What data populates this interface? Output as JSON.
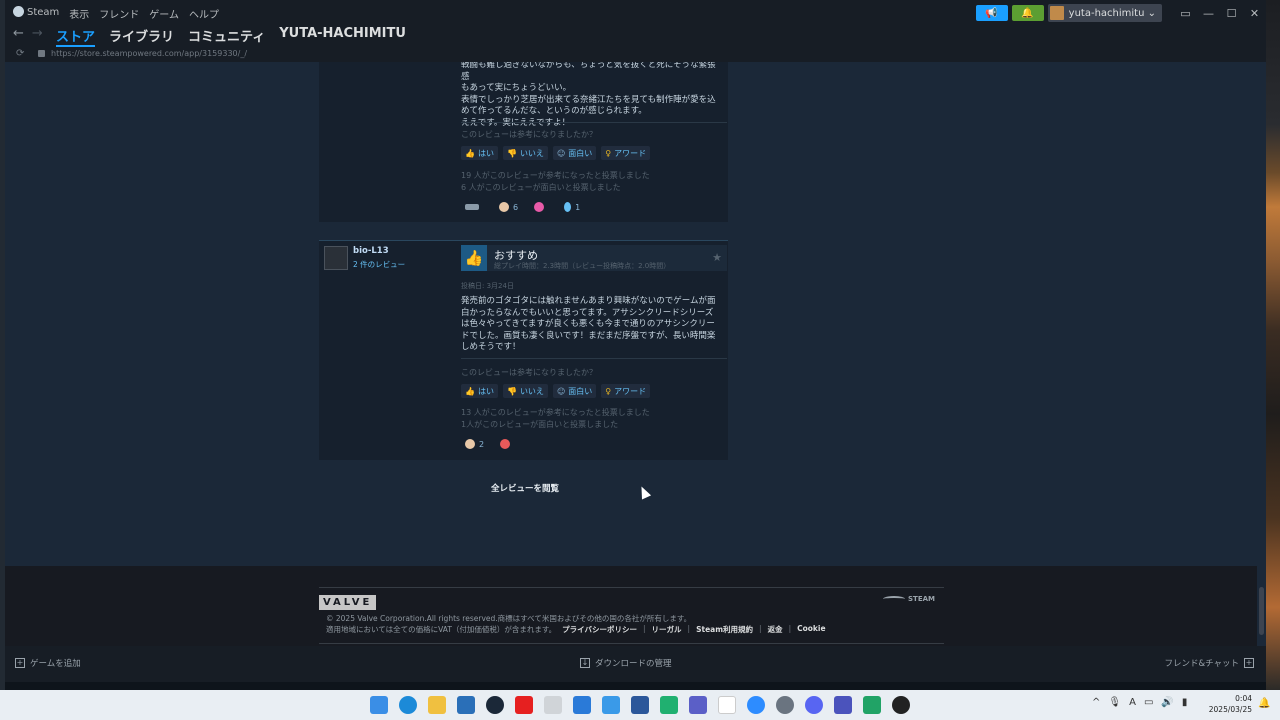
{
  "menubar": {
    "app": "Steam",
    "items": [
      "表示",
      "フレンド",
      "ゲーム",
      "ヘルプ"
    ]
  },
  "account": {
    "name": "yuta-hachimitu"
  },
  "nav": {
    "tabs": [
      "ストア",
      "ライブラリ",
      "コミュニティ",
      "YUTA-HACHIMITU"
    ]
  },
  "url": "https://store.steampowered.com/app/3159330/_/",
  "review1": {
    "body_lines": [
      "戦闘も難し過ぎないながらも、ちょっと気を抜くと死にそうな緊張感",
      "もあって実にちょうどいい。",
      "表情でしっかり芝居が出来てる奈緒江たちを見ても制作陣が愛を込",
      "めて作ってるんだな、というのが感じられます。",
      "ええです。実にええですよ！"
    ],
    "helpful_q": "このレビューは参考になりましたか？",
    "buttons": [
      "はい",
      "いいえ",
      "面白い",
      "アワード"
    ],
    "stats": [
      "19 人がこのレビューが参考になったと投票しました",
      "6 人がこのレビューが面白いと投票しました"
    ],
    "awards": [
      {
        "icon": "wings-award-icon",
        "count": ""
      },
      {
        "icon": "hand-award-icon",
        "count": "6"
      },
      {
        "icon": "heart-award-icon",
        "count": ""
      },
      {
        "icon": "medal-award-icon",
        "count": "1"
      }
    ]
  },
  "review2": {
    "author": "bio-L13",
    "author_reviews": "2 件のレビュー",
    "verdict": "おすすめ",
    "hours": "総プレイ時間：2.3時間（レビュー投稿時点：2.0時間）",
    "posted": "投稿日: 3月24日",
    "body_lines": [
      "発売前のゴタゴタには触れませんあまり興味がないのでゲームが面",
      "白かったらなんでもいいと思ってます。アサシンクリードシリーズ",
      "は色々やってきてますが良くも悪くも今まで通りのアサシンクリー",
      "ドでした。画質も凄く良いです！まだまだ序盤ですが、長い時間楽",
      "しめそうです！"
    ],
    "helpful_q": "このレビューは参考になりましたか？",
    "buttons": [
      "はい",
      "いいえ",
      "面白い",
      "アワード"
    ],
    "stats": [
      "13 人がこのレビューが参考になったと投票しました",
      "1人がこのレビューが面白いと投票しました"
    ],
    "awards": [
      {
        "icon": "hand-award-icon",
        "count": "2"
      },
      {
        "icon": "face-award-icon",
        "count": ""
      }
    ]
  },
  "view_all": "全レビューを閲覧",
  "footer": {
    "valve": "VALVE",
    "steam": "STEAM",
    "copyright": "© 2025 Valve Corporation.All rights reserved.商標はすべて米国およびその他の国の各社が所有します。",
    "vat": "適用地域においては全ての価格にVAT（付加価値税）が含まれます。",
    "links": [
      "プライバシーポリシー",
      "リーガル",
      "Steam利用規約",
      "返金",
      "Cookie"
    ]
  },
  "bottombar": {
    "add_game": "ゲームを追加",
    "downloads": "ダウンロードの管理",
    "friends": "フレンド&チャット"
  },
  "clock": {
    "time": "0:04",
    "date": "2025/03/25"
  },
  "colors": {
    "accent": "#1a9fff",
    "link": "#66c0f4",
    "bg": "#1b2838",
    "notif": "#5c9e32"
  }
}
